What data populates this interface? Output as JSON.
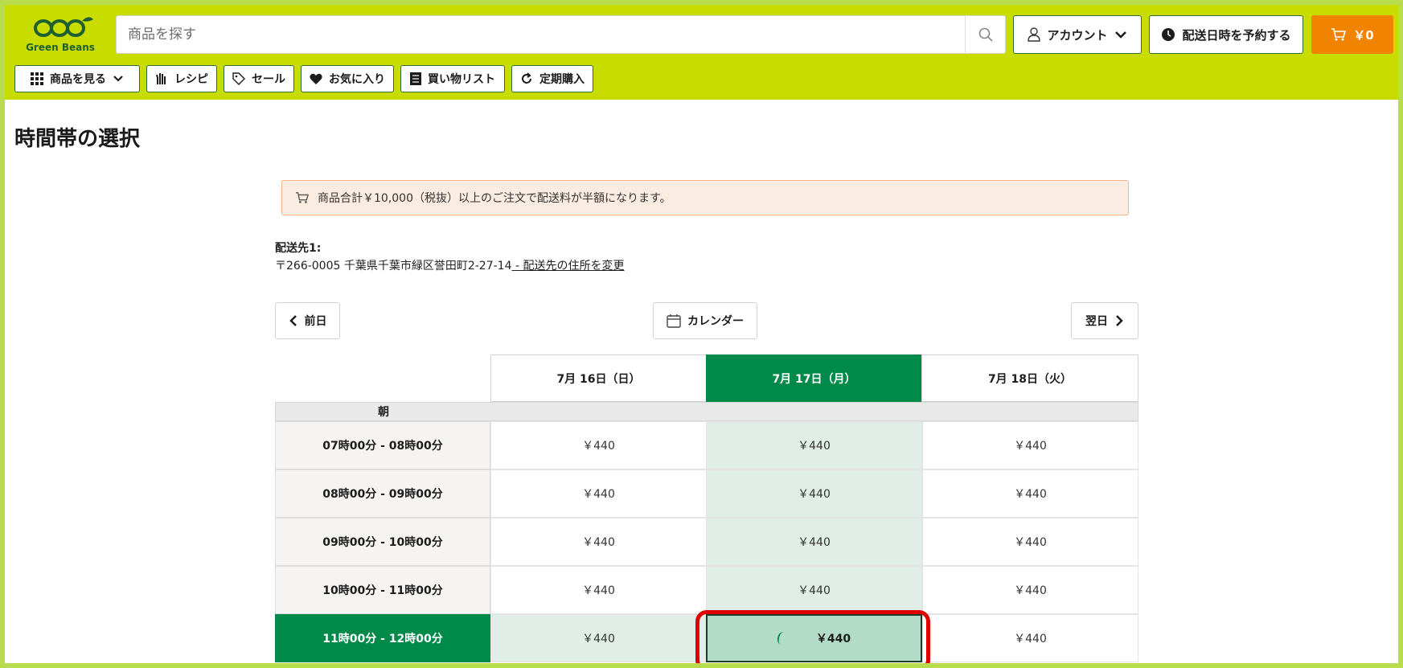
{
  "brand": {
    "name": "Green Beans",
    "accent": "#c8dc00",
    "primary_green": "#008a4a",
    "cart_orange": "#f08300",
    "logo_icon": "three-beans-logo"
  },
  "header": {
    "search_placeholder": "商品を探す",
    "account_label": "アカウント",
    "reserve_label": "配送日時を予約する",
    "cart_total": "￥0"
  },
  "nav": {
    "items": [
      {
        "label": "商品を見る",
        "icon": "grid-icon"
      },
      {
        "label": "レシピ",
        "icon": "hand-icon"
      },
      {
        "label": "セール",
        "icon": "tag-icon"
      },
      {
        "label": "お気に入り",
        "icon": "heart-icon"
      },
      {
        "label": "買い物リスト",
        "icon": "list-icon"
      },
      {
        "label": "定期購入",
        "icon": "refresh-icon"
      }
    ]
  },
  "page": {
    "title": "時間帯の選択",
    "notice": "商品合計￥10,000（税抜）以上のご注文で配送料が半額になります。",
    "address_label": "配送先1:",
    "address_text": "〒266-0005 千葉県千葉市緑区誉田町2-27-14",
    "address_link": " - 配送先の住所を変更"
  },
  "date_nav": {
    "prev": "前日",
    "calendar": "カレンダー",
    "next": "翌日"
  },
  "schedule": {
    "dates": [
      "7月 16日（日）",
      "7月 17日（月）",
      "7月 18日（火）"
    ],
    "active_date_index": 1,
    "section_label": "朝",
    "slots": [
      {
        "time": "07時00分 - 08時00分",
        "prices": [
          "￥440",
          "￥440",
          "￥440"
        ]
      },
      {
        "time": "08時00分 - 09時00分",
        "prices": [
          "￥440",
          "￥440",
          "￥440"
        ]
      },
      {
        "time": "09時00分 - 10時00分",
        "prices": [
          "￥440",
          "￥440",
          "￥440"
        ]
      },
      {
        "time": "10時00分 - 11時00分",
        "prices": [
          "￥440",
          "￥440",
          "￥440"
        ]
      },
      {
        "time": "11時00分 - 12時00分",
        "prices": [
          "￥440",
          "￥440",
          "￥440"
        ]
      }
    ],
    "selected_slot_index": 4
  }
}
